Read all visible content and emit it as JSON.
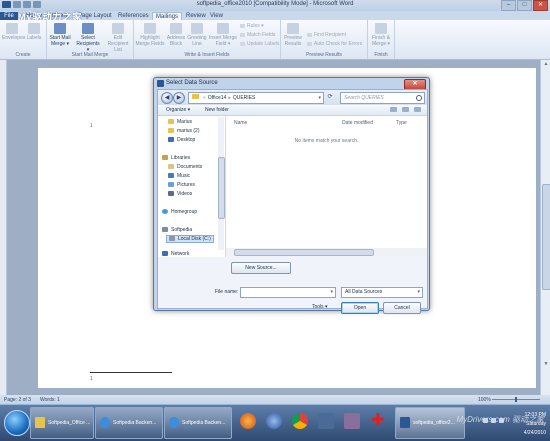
{
  "window": {
    "title": "softpedia_office2010 [Compatibility Mode] - Microsoft Word",
    "watermark": "My驱动力之家",
    "controls": {
      "min": "–",
      "max": "□",
      "close": "✕"
    }
  },
  "tabs": {
    "file": "File",
    "items": [
      "Home",
      "Insert",
      "Page Layout",
      "References",
      "Mailings",
      "Review",
      "View"
    ],
    "active": "Mailings"
  },
  "ribbon": {
    "create": {
      "label": "Create",
      "envelopes": "Envelopes",
      "labels": "Labels"
    },
    "start": {
      "label": "Start Mail Merge",
      "start_mail_merge": "Start Mail Merge ▾",
      "select_recipients": "Select Recipients ▾",
      "edit_recipient_list": "Edit Recipient List"
    },
    "write": {
      "label": "Write & Insert Fields",
      "highlight": "Highlight Merge Fields",
      "address_block": "Address Block",
      "greeting_line": "Greeting Line",
      "insert_merge_field": "Insert Merge Field ▾",
      "rules": "Rules ▾",
      "match_fields": "Match Fields",
      "update_labels": "Update Labels"
    },
    "preview": {
      "label": "Preview Results",
      "preview_results": "Preview Results",
      "find_recipient": "Find Recipient",
      "auto_check": "Auto Check for Errors"
    },
    "finish": {
      "label": "Finish",
      "finish_merge": "Finish & Merge ▾"
    }
  },
  "document": {
    "para_mark_1": "1",
    "para_mark_2": "1"
  },
  "statusbar": {
    "page": "Page: 2 of 3",
    "words": "Words: 1",
    "zoom": "100%"
  },
  "dialog": {
    "title": "Select Data Source",
    "close": "✕",
    "breadcrumb": [
      "Office14",
      "QUERIES"
    ],
    "search_placeholder": "Search QUERIES",
    "organize": "Organize ▾",
    "new_folder": "New folder",
    "nav_items": [
      "Marius",
      "marius (2)",
      "Desktop",
      "Libraries",
      "Documents",
      "Music",
      "Pictures",
      "Videos",
      "Homegroup",
      "Softpedia",
      "Local Disk (C:)",
      "Network"
    ],
    "columns": [
      "Name",
      "Date modified",
      "Type"
    ],
    "empty_message": "No items match your search.",
    "new_source": "New Source...",
    "file_name_label": "File name:",
    "file_name_value": "",
    "filter": "All Data Sources",
    "tools": "Tools ▾",
    "open": "Open",
    "cancel": "Cancel"
  },
  "taskbar": {
    "items": [
      "Softpedia_Office ...",
      "Softpedia Backen...",
      "Softpedia Backen...",
      "softpedia_office2..."
    ],
    "time": "12:03 PM",
    "day": "Saturday",
    "date": "4/24/2010"
  },
  "site_watermark": "MyDrivers.com 驱动之家"
}
